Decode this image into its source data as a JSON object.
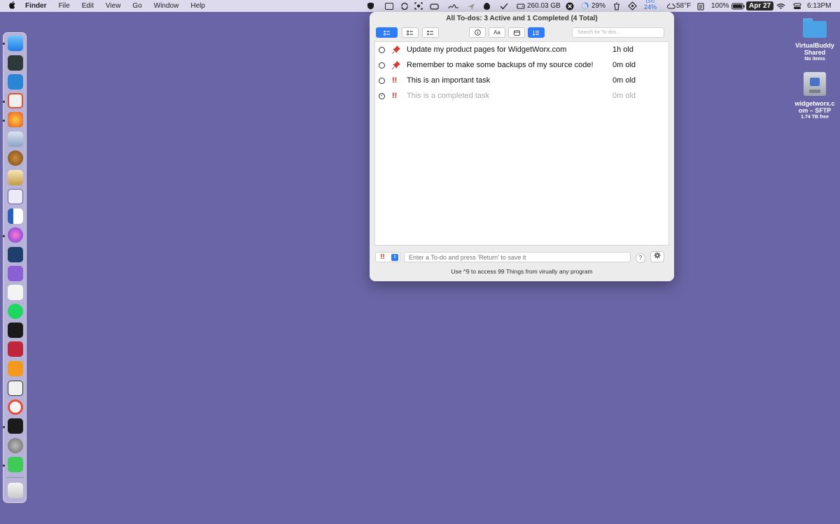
{
  "menubar": {
    "apple": "",
    "app_name": "Finder",
    "menus": [
      "File",
      "Edit",
      "View",
      "Go",
      "Window",
      "Help"
    ],
    "status": {
      "disk": "260.03 GB",
      "progress": "29%",
      "cpu_label": "CPU",
      "cpu_value": "24%",
      "weather": "58°F",
      "battery": "100%",
      "date": "Apr 27",
      "time": "6:13PM"
    }
  },
  "desktop": {
    "items": [
      {
        "name": "VirtualBuddy\nShared",
        "sub": "No items",
        "icon": "folder-icon"
      },
      {
        "name": "widgetworx.c\nom – SFTP",
        "sub": "1.74 TB free",
        "icon": "network-drive-icon"
      }
    ]
  },
  "window": {
    "title": "All To-dos: 3 Active and 1 Completed (4 Total)",
    "toolbar": {
      "font_button_label": "Aa",
      "search_placeholder": "Search for To-dos..."
    },
    "todos": [
      {
        "priority": "pin",
        "text": "Update my product pages for WidgetWorx.com",
        "age": "1h old",
        "completed": false
      },
      {
        "priority": "pin",
        "text": "Remember to make some backups of my source code!",
        "age": "0m old",
        "completed": false
      },
      {
        "priority": "!!",
        "text": "This is an important task",
        "age": "0m old",
        "completed": false
      },
      {
        "priority": "!!",
        "text": "This is a completed task",
        "age": "0m old",
        "completed": true
      }
    ],
    "new_todo": {
      "priority": "!!",
      "placeholder": "Enter a To-do and press 'Return' to save it"
    },
    "help_label": "?",
    "hint": "Use ^9 to access 99 Things from virually any program"
  },
  "colors": {
    "desktop": "#6a65a6",
    "accent": "#2f7cf6",
    "priority": "#d0211c"
  }
}
